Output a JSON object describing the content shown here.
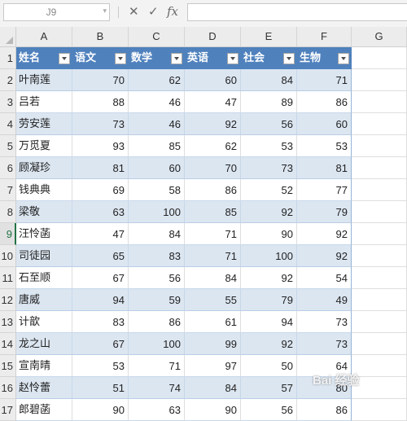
{
  "formula_bar": {
    "name_box": "J9",
    "cancel_icon": "close-icon",
    "enter_icon": "check-icon",
    "fx_label": "fx",
    "formula_value": ""
  },
  "sheet": {
    "selected_row": "9",
    "columns": [
      "A",
      "B",
      "C",
      "D",
      "E",
      "F",
      "G"
    ],
    "row_numbers": [
      "1",
      "2",
      "3",
      "4",
      "5",
      "6",
      "7",
      "8",
      "9",
      "10",
      "11",
      "12",
      "13",
      "14",
      "15",
      "16",
      "17"
    ],
    "table_headers": [
      "姓名",
      "语文",
      "数学",
      "英语",
      "社会",
      "生物"
    ],
    "rows": [
      [
        "叶南莲",
        "70",
        "62",
        "60",
        "84",
        "71"
      ],
      [
        "吕若",
        "88",
        "46",
        "47",
        "89",
        "86"
      ],
      [
        "劳安莲",
        "73",
        "46",
        "92",
        "56",
        "60"
      ],
      [
        "万觅夏",
        "93",
        "85",
        "62",
        "53",
        "53"
      ],
      [
        "顾凝珍",
        "81",
        "60",
        "70",
        "73",
        "81"
      ],
      [
        "钱典典",
        "69",
        "58",
        "86",
        "52",
        "77"
      ],
      [
        "梁敬",
        "63",
        "100",
        "85",
        "92",
        "79"
      ],
      [
        "汪怜菡",
        "47",
        "84",
        "71",
        "90",
        "92"
      ],
      [
        "司徒园",
        "65",
        "83",
        "71",
        "100",
        "92"
      ],
      [
        "石至顺",
        "67",
        "56",
        "84",
        "92",
        "54"
      ],
      [
        "唐威",
        "94",
        "59",
        "55",
        "79",
        "49"
      ],
      [
        "计歆",
        "83",
        "86",
        "61",
        "94",
        "73"
      ],
      [
        "龙之山",
        "67",
        "100",
        "99",
        "92",
        "73"
      ],
      [
        "宣南晴",
        "53",
        "71",
        "97",
        "50",
        "64"
      ],
      [
        "赵怜蕾",
        "51",
        "74",
        "84",
        "57",
        "80"
      ],
      [
        "郎碧菡",
        "90",
        "63",
        "90",
        "56",
        "86"
      ]
    ],
    "colors": {
      "header_fill": "#4f81bd",
      "band_fill": "#dce6f1",
      "accent": "#217346"
    }
  },
  "watermark": "Bai 经验"
}
